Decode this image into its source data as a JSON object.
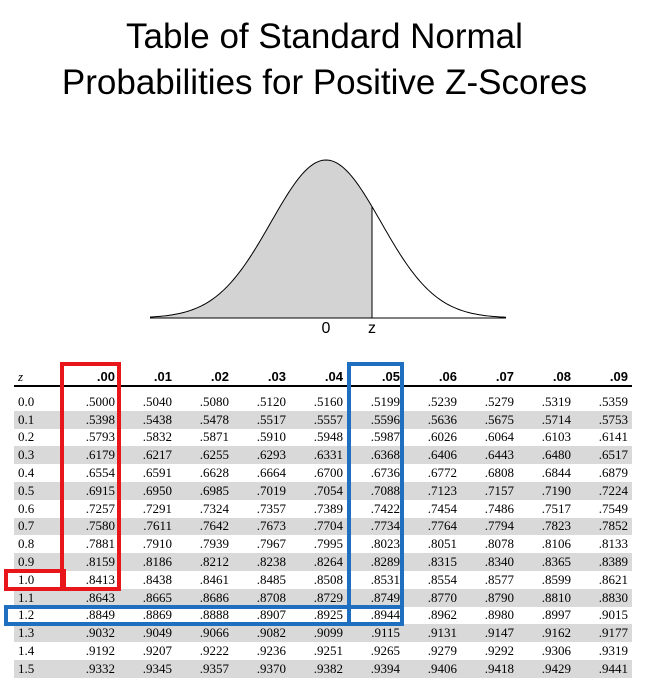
{
  "title": {
    "line1": "Table of Standard Normal",
    "line2": "Probabilities for Positive Z-Scores"
  },
  "curve": {
    "mean_label": "0",
    "z_label": "z",
    "shaded_fill": "#d3d3d3"
  },
  "table": {
    "z_header": "z",
    "columns": [
      ".00",
      ".01",
      ".02",
      ".03",
      ".04",
      ".05",
      ".06",
      ".07",
      ".08",
      ".09"
    ],
    "rows": [
      {
        "z": "0.0",
        "v": [
          ".5000",
          ".5040",
          ".5080",
          ".5120",
          ".5160",
          ".5199",
          ".5239",
          ".5279",
          ".5319",
          ".5359"
        ]
      },
      {
        "z": "0.1",
        "v": [
          ".5398",
          ".5438",
          ".5478",
          ".5517",
          ".5557",
          ".5596",
          ".5636",
          ".5675",
          ".5714",
          ".5753"
        ]
      },
      {
        "z": "0.2",
        "v": [
          ".5793",
          ".5832",
          ".5871",
          ".5910",
          ".5948",
          ".5987",
          ".6026",
          ".6064",
          ".6103",
          ".6141"
        ]
      },
      {
        "z": "0.3",
        "v": [
          ".6179",
          ".6217",
          ".6255",
          ".6293",
          ".6331",
          ".6368",
          ".6406",
          ".6443",
          ".6480",
          ".6517"
        ]
      },
      {
        "z": "0.4",
        "v": [
          ".6554",
          ".6591",
          ".6628",
          ".6664",
          ".6700",
          ".6736",
          ".6772",
          ".6808",
          ".6844",
          ".6879"
        ]
      },
      {
        "z": "0.5",
        "v": [
          ".6915",
          ".6950",
          ".6985",
          ".7019",
          ".7054",
          ".7088",
          ".7123",
          ".7157",
          ".7190",
          ".7224"
        ]
      },
      {
        "z": "0.6",
        "v": [
          ".7257",
          ".7291",
          ".7324",
          ".7357",
          ".7389",
          ".7422",
          ".7454",
          ".7486",
          ".7517",
          ".7549"
        ]
      },
      {
        "z": "0.7",
        "v": [
          ".7580",
          ".7611",
          ".7642",
          ".7673",
          ".7704",
          ".7734",
          ".7764",
          ".7794",
          ".7823",
          ".7852"
        ]
      },
      {
        "z": "0.8",
        "v": [
          ".7881",
          ".7910",
          ".7939",
          ".7967",
          ".7995",
          ".8023",
          ".8051",
          ".8078",
          ".8106",
          ".8133"
        ]
      },
      {
        "z": "0.9",
        "v": [
          ".8159",
          ".8186",
          ".8212",
          ".8238",
          ".8264",
          ".8289",
          ".8315",
          ".8340",
          ".8365",
          ".8389"
        ]
      },
      {
        "z": "1.0",
        "v": [
          ".8413",
          ".8438",
          ".8461",
          ".8485",
          ".8508",
          ".8531",
          ".8554",
          ".8577",
          ".8599",
          ".8621"
        ]
      },
      {
        "z": "1.1",
        "v": [
          ".8643",
          ".8665",
          ".8686",
          ".8708",
          ".8729",
          ".8749",
          ".8770",
          ".8790",
          ".8810",
          ".8830"
        ]
      },
      {
        "z": "1.2",
        "v": [
          ".8849",
          ".8869",
          ".8888",
          ".8907",
          ".8925",
          ".8944",
          ".8962",
          ".8980",
          ".8997",
          ".9015"
        ]
      },
      {
        "z": "1.3",
        "v": [
          ".9032",
          ".9049",
          ".9066",
          ".9082",
          ".9099",
          ".9115",
          ".9131",
          ".9147",
          ".9162",
          ".9177"
        ]
      },
      {
        "z": "1.4",
        "v": [
          ".9192",
          ".9207",
          ".9222",
          ".9236",
          ".9251",
          ".9265",
          ".9279",
          ".9292",
          ".9306",
          ".9319"
        ]
      },
      {
        "z": "1.5",
        "v": [
          ".9332",
          ".9345",
          ".9357",
          ".9370",
          ".9382",
          ".9394",
          ".9406",
          ".9418",
          ".9429",
          ".9441"
        ]
      }
    ],
    "shade_color": "#d9d9d9"
  },
  "highlights": {
    "red_color": "#e8161b",
    "blue_color": "#1f6fc1",
    "red_column": ".00",
    "red_row": "1.0",
    "blue_column": ".05",
    "blue_row": "1.2"
  }
}
